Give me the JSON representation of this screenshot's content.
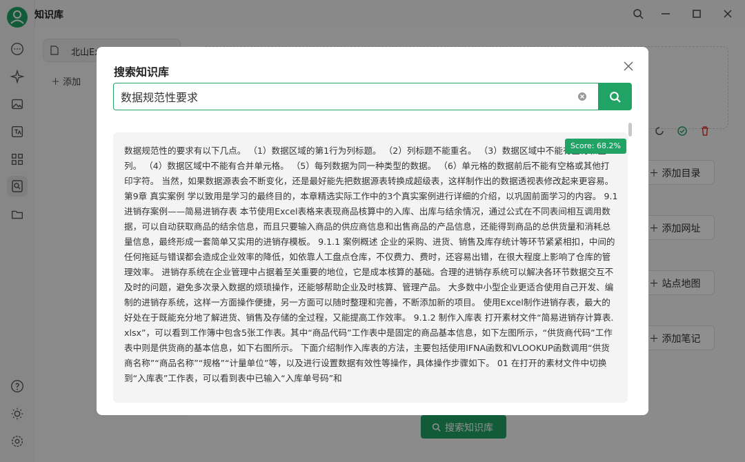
{
  "app": {
    "title": "知识库"
  },
  "knowledge_list": {
    "items": [
      {
        "label": "北山Exc"
      }
    ],
    "add_label": "添加"
  },
  "main": {
    "side_buttons": [
      {
        "label": "添加目录"
      },
      {
        "label": "添加网址"
      },
      {
        "label": "站点地图"
      },
      {
        "label": "添加笔记"
      }
    ],
    "search_kb_label": "搜索知识库"
  },
  "dialog": {
    "title": "搜索知识库",
    "search_value": "数据规范性要求",
    "result": {
      "score": "Score: 68.2%",
      "text": "数据规范性的要求有以下几点。 （1）数据区域的第1行为列标题。 （2）列标题不能重名。 （3）数据区域中不能有空行和空列。 （4）数据区域中不能有合并单元格。 （5）每列数据为同一种类型的数据。 （6）单元格的数据前后不能有空格或其他打印字符。 当然，如果数据源表会不断变化，还是最好能先把数据源表转换成超级表，这样制作出的数据透视表修改起来更容易。 第9章 真实案例 学以致用是学习的最终目的，本章精选实际工作中的3个真实案例进行详细的介绍，以巩固前面学习的内容。 9.1 进销存案例——简易进销存表 本节使用Excel表格来表现商品核算中的入库、出库与结余情况，通过公式在不同表间相互调用数据，可以自动获取商品的结余信息，而且只要输入商品的供应商信息和出售商品的产品信息，还能得到商品的总供货量和消耗总量信息，最终形成一套简单又实用的进销存模板。 9.1.1 案例概述 企业的采购、进货、销售及库存统计等环节紧紧相扣，中间的任何拖延与错误都会造成企业效率的降低，如依靠人工盘点仓库，不仅费力、费时，还容易出错，在很大程度上影响了仓库的管理效率。 进销存系统在企业管理中占据着至关重要的地位，它是成本核算的基础。合理的进销存系统可以解决各环节数据交互不及时的问题，避免多次录入数据的烦琐操作，还能够帮助企业及时核算、管理产品。 大多数中小型企业更适合使用自己开发、编制的进销存系统，这样一方面操作便捷，另一方面可以随时整理和完善，不断添加新的项目。 使用Excel制作进销存表，最大的好处在于既能充分地了解进货、销售及存储的全过程，又能提高工作效率。 9.1.2 制作入库表 打开素材文件“简易进销存计算表.xlsx”，可以看到工作簿中包含5张工作表。其中“商品代码”工作表中是固定的商品基本信息，如下左图所示，“供货商代码”工作表中则是供货商的基本信息，如下右图所示。 下面介绍制作入库表的方法，主要包括使用IFNA函数和VLOOKUP函数调用“供货商名称”“商品名称”“规格”“计量单位”等，以及进行设置数据有效性等操作，具体操作步骤如下。 01 在打开的素材文件中切换到“入库表”工作表，可以看到表中已输入“入库单号码”和"
    }
  },
  "colors": {
    "accent": "#21a366",
    "delete": "#e53935"
  },
  "icons": [
    "chat-icon",
    "sparkle-icon",
    "image-icon",
    "translate-icon",
    "apps-icon",
    "knowledge-icon",
    "folder-icon",
    "help-icon",
    "theme-icon",
    "settings-icon",
    "search-icon",
    "minimize-icon",
    "maximize-icon",
    "close-icon"
  ]
}
